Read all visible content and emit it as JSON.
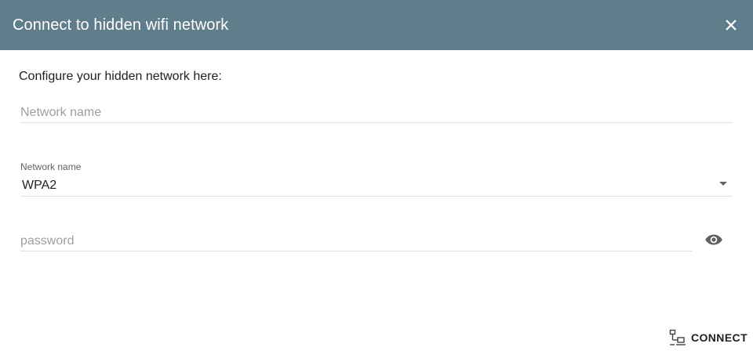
{
  "dialog": {
    "title": "Connect to hidden wifi network",
    "close_icon": "close-icon",
    "intro": "Configure your hidden network here:",
    "ssid": {
      "placeholder": "Network name",
      "value": ""
    },
    "security": {
      "label": "Network name",
      "selected": "WPA2",
      "arrow_icon": "dropdown-arrow-icon"
    },
    "password": {
      "placeholder": "password",
      "value": "",
      "visibility_icon": "eye-icon"
    },
    "connect": {
      "label": "CONNECT",
      "icon": "network-connect-icon"
    }
  },
  "colors": {
    "header": "#607d8b",
    "header_text": "#ffffff",
    "text": "#212121",
    "placeholder": "#9e9e9e",
    "divider": "#e0e0e0",
    "icon": "#616161"
  }
}
